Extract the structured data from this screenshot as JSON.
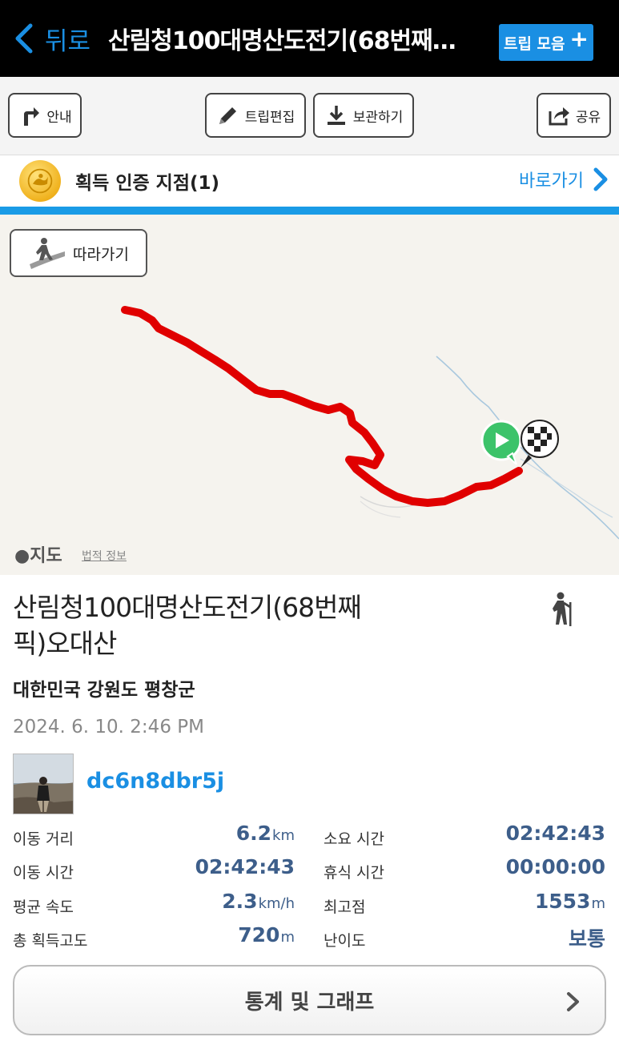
{
  "nav": {
    "back_label": "뒤로",
    "title": "산림청100대명산도전기(68번째…",
    "trip_collection_label": "트립 모음"
  },
  "toolbar": {
    "guide_label": "안내",
    "edit_label": "트립편집",
    "save_label": "보관하기",
    "share_label": "공유"
  },
  "badge": {
    "label": "획득 인증 지점(1)",
    "shortcut_label": "바로가기"
  },
  "map": {
    "follow_label": "따라가기",
    "maps_label": "지도",
    "legal_label": "법적 정보"
  },
  "trip": {
    "title": "산림청100대명산도전기(68번째픽)오대산",
    "activity_icon": "hiker-icon",
    "region": "대한민국 강원도 평창군",
    "date": "2024. 6. 10. 2:46 PM",
    "username": "dc6n8dbr5j"
  },
  "stats": {
    "distance": {
      "label": "이동 거리",
      "value": "6.2",
      "unit": "km"
    },
    "total_time": {
      "label": "소요 시간",
      "value": "02:42:43",
      "unit": ""
    },
    "moving_time": {
      "label": "이동 시간",
      "value": "02:42:43",
      "unit": ""
    },
    "rest_time": {
      "label": "휴식 시간",
      "value": "00:00:00",
      "unit": ""
    },
    "avg_speed": {
      "label": "평균 속도",
      "value": "2.3",
      "unit": "km/h"
    },
    "max_alt": {
      "label": "최고점",
      "value": "1553",
      "unit": "m"
    },
    "total_ascent": {
      "label": "총 획득고도",
      "value": "720",
      "unit": "m"
    },
    "difficulty": {
      "label": "난이도",
      "value": "보통",
      "unit": ""
    }
  },
  "graph_button_label": "통계 및 그래프",
  "colors": {
    "accent": "#1a8fe3",
    "route": "#e00000",
    "stat_value": "#3d5e8a"
  }
}
